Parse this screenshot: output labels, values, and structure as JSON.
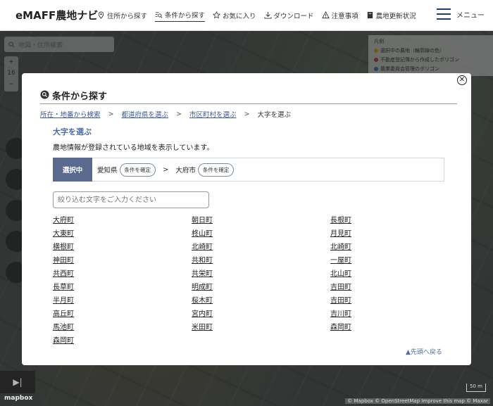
{
  "header": {
    "brand": "eMAFF農地ナビ",
    "nav": [
      {
        "label": "住所から探す",
        "icon": "pin-icon"
      },
      {
        "label": "条件から探す",
        "icon": "filter-search-icon"
      },
      {
        "label": "お気に入り",
        "icon": "star-icon"
      },
      {
        "label": "ダウンロード",
        "icon": "download-icon"
      },
      {
        "label": "注意事項",
        "icon": "warning-icon"
      },
      {
        "label": "農地更新状況",
        "icon": "book-icon"
      }
    ],
    "menu_label": "メニュー"
  },
  "map": {
    "search_placeholder": "地図・住所検索",
    "zoom_level": "16",
    "legend_title": "凡例",
    "legend_items": [
      {
        "label": "選択中の農地（輪郭線の色）",
        "color": "#e8c000"
      },
      {
        "label": "不動産登記簿から作成したポリゴン",
        "color": "#d33"
      },
      {
        "label": "農業委員会管理のポリゴン",
        "color": "#3a7bd5"
      }
    ],
    "mapbox_label": "mapbox",
    "attribution": "© Mapbox © OpenStreetMap Improve this map © Maxar",
    "scale_label": "50 m"
  },
  "modal": {
    "title": "条件から探す",
    "breadcrumb": {
      "link1": "所在・地番から検索",
      "link2": "都道府県を選ぶ",
      "link3": "市区町村を選ぶ",
      "current": "大字を選ぶ",
      "sep": ">"
    },
    "section_title": "大字を選ぶ",
    "section_desc": "農地情報が登録されている地域を表示しています。",
    "selected": {
      "label": "選択中",
      "prefecture": "愛知県",
      "city": "大府市",
      "confirm_label": "条件を確定",
      "arrow": ">"
    },
    "filter_placeholder": "絞り込む文字をご入力ください",
    "towns": [
      "大府町",
      "朝日町",
      "長根町",
      "大東町",
      "柊山町",
      "月見町",
      "横根町",
      "北崎町",
      "北崎町",
      "神田町",
      "共和町",
      "一屋町",
      "共西町",
      "共栄町",
      "北山町",
      "長草町",
      "明成町",
      "吉田町",
      "半月町",
      "桜木町",
      "吉田町",
      "高丘町",
      "宮内町",
      "吉川町",
      "馬池町",
      "米田町",
      "森岡町",
      "森岡町"
    ],
    "back_to_top": "▲先頭へ戻る"
  }
}
